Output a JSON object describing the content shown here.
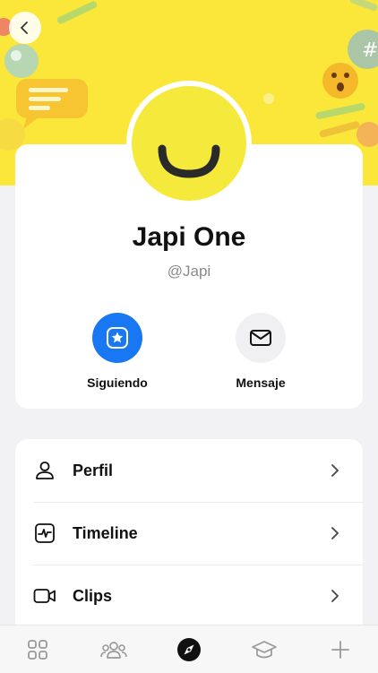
{
  "profile": {
    "name": "Japi One",
    "handle": "@Japi"
  },
  "actions": {
    "following_label": "Siguiendo",
    "message_label": "Mensaje"
  },
  "menu": {
    "items": [
      {
        "label": "Perfil",
        "icon": "user-icon"
      },
      {
        "label": "Timeline",
        "icon": "activity-icon"
      },
      {
        "label": "Clips",
        "icon": "video-icon"
      }
    ]
  },
  "tabbar": {
    "items": [
      {
        "icon": "grid-icon",
        "active": false
      },
      {
        "icon": "group-icon",
        "active": false
      },
      {
        "icon": "compass-icon",
        "active": true
      },
      {
        "icon": "graduation-cap-icon",
        "active": false
      },
      {
        "icon": "plus-icon",
        "active": false
      }
    ]
  },
  "colors": {
    "banner": "#fbe73a",
    "accent_blue": "#1877f2",
    "avatar_yellow": "#f5ea3c"
  }
}
